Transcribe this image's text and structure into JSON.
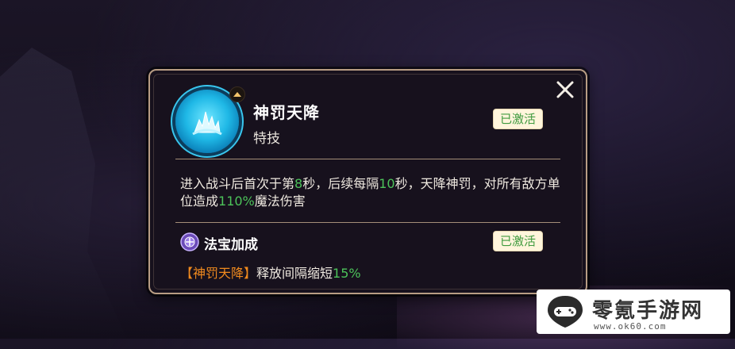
{
  "skill": {
    "name": "神罚天降",
    "type": "特技",
    "status": "已激活",
    "icon": "blue-flame-skill-icon"
  },
  "description": {
    "part1": "进入战斗后首次于第",
    "v1": "8",
    "part2": "秒，后续每隔",
    "v2": "10",
    "part3": "秒，天降神罚，对所有敌方单位造成",
    "v3": "110%",
    "part4": "魔法伤害"
  },
  "treasure": {
    "title": "法宝加成",
    "status": "已激活",
    "skill_ref": "【神罚天降】",
    "desc": "释放间隔缩短",
    "value": "15%"
  },
  "watermark": {
    "title": "零氪手游网",
    "url": "www.ok60.com"
  },
  "colors": {
    "accent_green": "#4cc35a",
    "accent_orange": "#f08a1e",
    "border": "#b89d84"
  }
}
